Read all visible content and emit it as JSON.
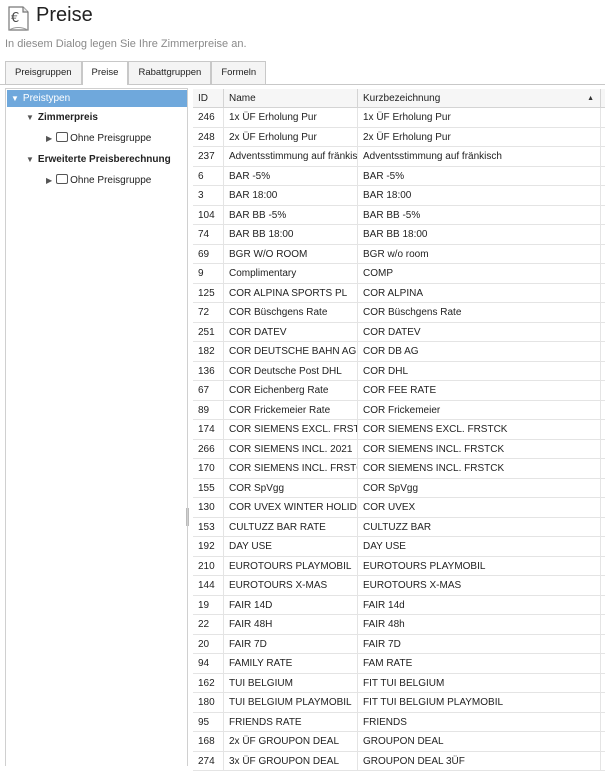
{
  "header": {
    "title": "Preise",
    "subtitle": "In diesem Dialog legen Sie Ihre Zimmerpreise an.",
    "icon": "euro-document-icon"
  },
  "tabs": [
    {
      "label": "Preisgruppen",
      "active": false
    },
    {
      "label": "Preise",
      "active": true
    },
    {
      "label": "Rabattgruppen",
      "active": false
    },
    {
      "label": "Formeln",
      "active": false
    }
  ],
  "tree": {
    "root": "Preistypen",
    "nodes": [
      {
        "label": "Zimmerpreis",
        "bold": true
      },
      {
        "label": "Ohne Preisgruppe",
        "bold": false
      },
      {
        "label": "Erweiterte Preisberechnung",
        "bold": true
      },
      {
        "label": "Ohne Preisgruppe",
        "bold": false
      }
    ]
  },
  "grid": {
    "columns": {
      "id": "ID",
      "name": "Name",
      "kurz": "Kurzbezeichnung"
    },
    "sort": "ascending",
    "rows": [
      {
        "id": "246",
        "name": "1x ÜF Erholung Pur",
        "kurz": "1x ÜF Erholung Pur"
      },
      {
        "id": "248",
        "name": "2x ÜF Erholung Pur",
        "kurz": "2x ÜF Erholung Pur"
      },
      {
        "id": "237",
        "name": "Adventsstimmung auf fränkisch",
        "kurz": "Adventsstimmung auf fränkisch"
      },
      {
        "id": "6",
        "name": "BAR -5%",
        "kurz": "BAR -5%"
      },
      {
        "id": "3",
        "name": "BAR 18:00",
        "kurz": "BAR 18:00"
      },
      {
        "id": "104",
        "name": "BAR BB -5%",
        "kurz": "BAR BB -5%"
      },
      {
        "id": "74",
        "name": "BAR BB 18:00",
        "kurz": "BAR BB 18:00"
      },
      {
        "id": "69",
        "name": "BGR W/O ROOM",
        "kurz": "BGR w/o room"
      },
      {
        "id": "9",
        "name": "Complimentary",
        "kurz": "COMP"
      },
      {
        "id": "125",
        "name": "COR ALPINA SPORTS PL",
        "kurz": "COR ALPINA"
      },
      {
        "id": "72",
        "name": "COR Büschgens Rate",
        "kurz": "COR Büschgens Rate"
      },
      {
        "id": "251",
        "name": "COR DATEV",
        "kurz": "COR DATEV"
      },
      {
        "id": "182",
        "name": "COR DEUTSCHE BAHN AG",
        "kurz": "COR DB AG"
      },
      {
        "id": "136",
        "name": "COR Deutsche Post DHL",
        "kurz": "COR DHL"
      },
      {
        "id": "67",
        "name": "COR Eichenberg Rate",
        "kurz": "COR FEE RATE"
      },
      {
        "id": "89",
        "name": "COR Frickemeier Rate",
        "kurz": "COR Frickemeier"
      },
      {
        "id": "174",
        "name": "COR SIEMENS EXCL. FRSTCK",
        "kurz": "COR SIEMENS EXCL. FRSTCK"
      },
      {
        "id": "266",
        "name": "COR SIEMENS INCL. 2021",
        "kurz": "COR SIEMENS INCL. FRSTCK"
      },
      {
        "id": "170",
        "name": "COR SIEMENS INCL. FRSTCK",
        "kurz": "COR SIEMENS INCL. FRSTCK"
      },
      {
        "id": "155",
        "name": "COR SpVgg",
        "kurz": "COR SpVgg"
      },
      {
        "id": "130",
        "name": "COR UVEX WINTER HOLIDAY",
        "kurz": "COR UVEX"
      },
      {
        "id": "153",
        "name": "CULTUZZ BAR RATE",
        "kurz": "CULTUZZ BAR"
      },
      {
        "id": "192",
        "name": "DAY USE",
        "kurz": "DAY USE"
      },
      {
        "id": "210",
        "name": "EUROTOURS PLAYMOBIL",
        "kurz": "EUROTOURS PLAYMOBIL"
      },
      {
        "id": "144",
        "name": "EUROTOURS X-MAS",
        "kurz": "EUROTOURS X-MAS"
      },
      {
        "id": "19",
        "name": "FAIR 14D",
        "kurz": "FAIR 14d"
      },
      {
        "id": "22",
        "name": "FAIR 48H",
        "kurz": "FAIR 48h"
      },
      {
        "id": "20",
        "name": "FAIR 7D",
        "kurz": "FAIR 7D"
      },
      {
        "id": "94",
        "name": "FAMILY RATE",
        "kurz": "FAM RATE"
      },
      {
        "id": "162",
        "name": "TUI BELGIUM",
        "kurz": "FIT TUI BELGIUM"
      },
      {
        "id": "180",
        "name": "TUI BELGIUM PLAYMOBIL",
        "kurz": "FIT TUI BELGIUM PLAYMOBIL"
      },
      {
        "id": "95",
        "name": "FRIENDS RATE",
        "kurz": "FRIENDS"
      },
      {
        "id": "168",
        "name": "2x ÜF GROUPON DEAL",
        "kurz": "GROUPON  DEAL"
      },
      {
        "id": "274",
        "name": "3x ÜF GROUPON DEAL",
        "kurz": "GROUPON  DEAL 3ÜF"
      }
    ]
  }
}
